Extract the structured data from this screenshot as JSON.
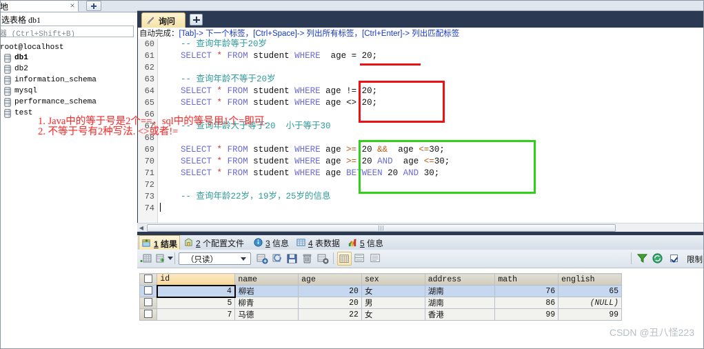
{
  "left_panel": {
    "tab_label": "地",
    "tab_close_glyph": "×",
    "header_text": "选表格  db1",
    "search_placeholder": "器  (Ctrl+Shift+B)",
    "tree_root": "root@localhost",
    "tree_items": [
      {
        "label": "db1",
        "bold": true
      },
      {
        "label": "db2",
        "bold": false
      },
      {
        "label": "information_schema",
        "bold": false
      },
      {
        "label": "mysql",
        "bold": false
      },
      {
        "label": "performance_schema",
        "bold": false
      },
      {
        "label": "test",
        "bold": false
      }
    ]
  },
  "query_tabs": {
    "active_tab": "询问",
    "new_tab_label": "+"
  },
  "editor": {
    "hint_prefix": "自动完成：",
    "hint_text": "[Tab]-> 下一个标签，[Ctrl+Space]-> 列出所有标签，[Ctrl+Enter]-> 列出匹配标签",
    "lines": [
      {
        "n": "60",
        "parts": [
          {
            "t": "    ",
            "c": "plain"
          },
          {
            "t": "-- 查询年龄等于20岁",
            "c": "cmt"
          }
        ]
      },
      {
        "n": "61",
        "parts": [
          {
            "t": "    ",
            "c": "plain"
          },
          {
            "t": "SELECT",
            "c": "kw"
          },
          {
            "t": " ",
            "c": "plain"
          },
          {
            "t": "*",
            "c": "star"
          },
          {
            "t": " ",
            "c": "plain"
          },
          {
            "t": "FROM",
            "c": "kw"
          },
          {
            "t": " student ",
            "c": "plain"
          },
          {
            "t": "WHERE",
            "c": "kw"
          },
          {
            "t": "  age = 20;",
            "c": "plain"
          }
        ]
      },
      {
        "n": "62",
        "parts": []
      },
      {
        "n": "63",
        "parts": [
          {
            "t": "    ",
            "c": "plain"
          },
          {
            "t": "-- 查询年龄不等于20岁",
            "c": "cmt"
          }
        ]
      },
      {
        "n": "64",
        "parts": [
          {
            "t": "    ",
            "c": "plain"
          },
          {
            "t": "SELECT",
            "c": "kw"
          },
          {
            "t": " ",
            "c": "plain"
          },
          {
            "t": "*",
            "c": "star"
          },
          {
            "t": " ",
            "c": "plain"
          },
          {
            "t": "FROM",
            "c": "kw"
          },
          {
            "t": " student ",
            "c": "plain"
          },
          {
            "t": "WHERE",
            "c": "kw"
          },
          {
            "t": " age != 20;",
            "c": "plain"
          }
        ]
      },
      {
        "n": "65",
        "parts": [
          {
            "t": "    ",
            "c": "plain"
          },
          {
            "t": "SELECT",
            "c": "kw"
          },
          {
            "t": " ",
            "c": "plain"
          },
          {
            "t": "*",
            "c": "star"
          },
          {
            "t": " ",
            "c": "plain"
          },
          {
            "t": "FROM",
            "c": "kw"
          },
          {
            "t": " student ",
            "c": "plain"
          },
          {
            "t": "WHERE",
            "c": "kw"
          },
          {
            "t": " age <> 20;",
            "c": "plain"
          }
        ]
      },
      {
        "n": "66",
        "parts": []
      },
      {
        "n": "67",
        "parts": [
          {
            "t": "    ",
            "c": "plain"
          },
          {
            "t": "-- 查询年龄大于等于20  小于等于30",
            "c": "cmt"
          }
        ]
      },
      {
        "n": "68",
        "parts": []
      },
      {
        "n": "69",
        "parts": [
          {
            "t": "    ",
            "c": "plain"
          },
          {
            "t": "SELECT",
            "c": "kw"
          },
          {
            "t": " ",
            "c": "plain"
          },
          {
            "t": "*",
            "c": "star"
          },
          {
            "t": " ",
            "c": "plain"
          },
          {
            "t": "FROM",
            "c": "kw"
          },
          {
            "t": " student ",
            "c": "plain"
          },
          {
            "t": "WHERE",
            "c": "kw"
          },
          {
            "t": " age ",
            "c": "plain"
          },
          {
            "t": ">=",
            "c": "op"
          },
          {
            "t": " 20 ",
            "c": "plain"
          },
          {
            "t": "&&",
            "c": "op"
          },
          {
            "t": "  age ",
            "c": "plain"
          },
          {
            "t": "<=",
            "c": "op"
          },
          {
            "t": "30;",
            "c": "plain"
          }
        ]
      },
      {
        "n": "70",
        "parts": [
          {
            "t": "    ",
            "c": "plain"
          },
          {
            "t": "SELECT",
            "c": "kw"
          },
          {
            "t": " ",
            "c": "plain"
          },
          {
            "t": "*",
            "c": "star"
          },
          {
            "t": " ",
            "c": "plain"
          },
          {
            "t": "FROM",
            "c": "kw"
          },
          {
            "t": " student ",
            "c": "plain"
          },
          {
            "t": "WHERE",
            "c": "kw"
          },
          {
            "t": " age ",
            "c": "plain"
          },
          {
            "t": ">=",
            "c": "op"
          },
          {
            "t": " 20 ",
            "c": "plain"
          },
          {
            "t": "AND",
            "c": "kw"
          },
          {
            "t": "  age ",
            "c": "plain"
          },
          {
            "t": "<=",
            "c": "op"
          },
          {
            "t": "30;",
            "c": "plain"
          }
        ]
      },
      {
        "n": "71",
        "parts": [
          {
            "t": "    ",
            "c": "plain"
          },
          {
            "t": "SELECT",
            "c": "kw"
          },
          {
            "t": " ",
            "c": "plain"
          },
          {
            "t": "*",
            "c": "star"
          },
          {
            "t": " ",
            "c": "plain"
          },
          {
            "t": "FROM",
            "c": "kw"
          },
          {
            "t": " student ",
            "c": "plain"
          },
          {
            "t": "WHERE",
            "c": "kw"
          },
          {
            "t": " age ",
            "c": "plain"
          },
          {
            "t": "BETWEEN",
            "c": "kw"
          },
          {
            "t": " 20 ",
            "c": "plain"
          },
          {
            "t": "AND",
            "c": "kw"
          },
          {
            "t": " 30;",
            "c": "plain"
          }
        ]
      },
      {
        "n": "72",
        "parts": []
      },
      {
        "n": "73",
        "parts": [
          {
            "t": "    ",
            "c": "plain"
          },
          {
            "t": "-- 查询年龄22岁，19岁，25岁的信息",
            "c": "cmt"
          }
        ]
      },
      {
        "n": "74",
        "parts": []
      }
    ],
    "scroll_thumb_glyph": "|||"
  },
  "result_tabs": [
    {
      "num": "1",
      "label": "结果",
      "active": true,
      "icon": "grid-icon"
    },
    {
      "num": "2",
      "label": "个配置文件",
      "active": false,
      "icon": "profile-icon"
    },
    {
      "num": "3",
      "label": "信息",
      "active": false,
      "icon": "info-icon"
    },
    {
      "num": "4",
      "label": "表数据",
      "active": false,
      "icon": "table-icon"
    },
    {
      "num": "5",
      "label": "信息",
      "active": false,
      "icon": "status-icon"
    }
  ],
  "grid_toolbar": {
    "mode_value": "（只读）",
    "limit_label": "限制",
    "icons": [
      "add-row-icon",
      "export-icon",
      "dropdown-arrow-icon",
      "insert-row-icon",
      "refresh-icon",
      "save-icon",
      "delete-icon",
      "cancel-icon",
      "grid-view-icon",
      "form-view-icon",
      "text-view-icon",
      "filter-icon",
      "refresh-green-icon"
    ]
  },
  "grid": {
    "columns": [
      "id",
      "name",
      "age",
      "sex",
      "address",
      "math",
      "english"
    ],
    "active_column": "id",
    "rows": [
      {
        "selected": true,
        "cells": [
          "4",
          "柳岩",
          "20",
          "女",
          "湖南",
          "76",
          "65"
        ]
      },
      {
        "selected": false,
        "cells": [
          "5",
          "柳青",
          "20",
          "男",
          "湖南",
          "86",
          "(NULL)"
        ]
      },
      {
        "selected": false,
        "cells": [
          "7",
          "马德",
          "22",
          "女",
          "香港",
          "99",
          "99"
        ]
      }
    ]
  },
  "annotations": {
    "note_line1": "1. Java中的等于号是2个==，sql中的等号用1个=即可.",
    "note_line2": "2. 不等于号有2种写法. <>或者!=",
    "red_color": "#ee1111",
    "green_color": "#2fd018",
    "note_color": "#f03a3a"
  },
  "watermark": "CSDN @丑八怪223"
}
